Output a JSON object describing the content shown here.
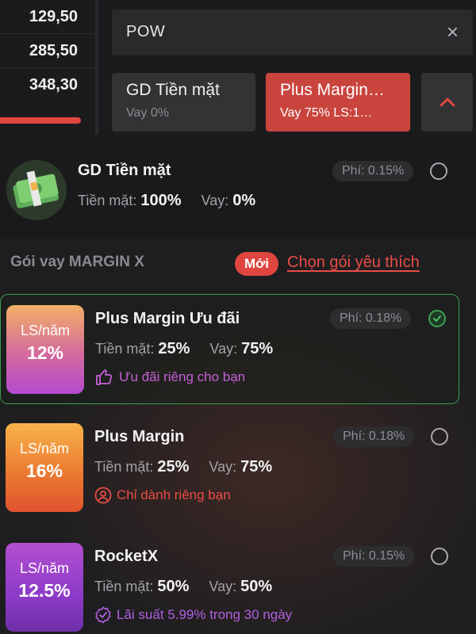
{
  "prices": [
    "129,50",
    "285,50",
    "348,30"
  ],
  "search": {
    "value": "POW",
    "close_icon": "×"
  },
  "tabs": [
    {
      "title": "GD Tiền mặt",
      "subtitle": "Vay 0%"
    },
    {
      "title": "Plus Margin…",
      "subtitle": "Vay 75% LS:1…"
    }
  ],
  "cash": {
    "title": "GD Tiền mặt",
    "cash_label": "Tiền mặt:",
    "cash_value": "100%",
    "loan_label": "Vay:",
    "loan_value": "0%",
    "fee": "Phí: 0.15%"
  },
  "margin": {
    "heading": "Gói vay MARGIN X",
    "new_badge": "Mới",
    "pick_link": "Chọn gói yêu thích"
  },
  "packages": [
    {
      "rate_label": "LS/năm",
      "rate": "12%",
      "name": "Plus Margin Ưu đãi",
      "fee": "Phí: 0.18%",
      "cash_label": "Tiền mặt:",
      "cash_value": "25%",
      "loan_label": "Vay:",
      "loan_value": "75%",
      "note": "Ưu đãi riêng cho bạn",
      "selected": true
    },
    {
      "rate_label": "LS/năm",
      "rate": "16%",
      "name": "Plus Margin",
      "fee": "Phí: 0.18%",
      "cash_label": "Tiền mặt:",
      "cash_value": "25%",
      "loan_label": "Vay:",
      "loan_value": "75%",
      "note": "Chỉ dành riêng bạn",
      "selected": false
    },
    {
      "rate_label": "LS/năm",
      "rate": "12.5%",
      "name": "RocketX",
      "fee": "Phí: 0.15%",
      "cash_label": "Tiền mặt:",
      "cash_value": "50%",
      "loan_label": "Vay:",
      "loan_value": "50%",
      "note": "Lãi suất 5.99% trong 30 ngày",
      "selected": false
    }
  ],
  "colors": {
    "accent_red": "#e0463f",
    "selected_green": "#3fa052",
    "background": "#1b1b1d"
  }
}
